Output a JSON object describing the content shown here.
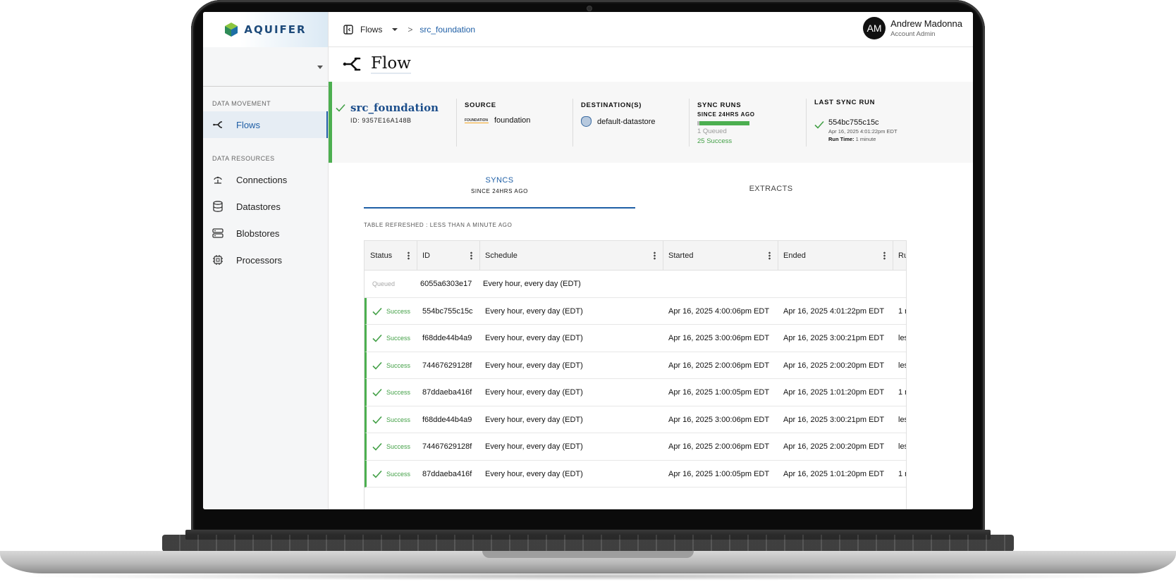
{
  "brand": {
    "name": "AQUIFER"
  },
  "sidebar": {
    "sections": [
      {
        "title": "DATA MOVEMENT",
        "items": [
          {
            "label": "Flows",
            "icon": "flow-icon",
            "active": true
          }
        ]
      },
      {
        "title": "DATA RESOURCES",
        "items": [
          {
            "label": "Connections",
            "icon": "connection-icon"
          },
          {
            "label": "Datastores",
            "icon": "database-icon"
          },
          {
            "label": "Blobstores",
            "icon": "server-icon"
          },
          {
            "label": "Processors",
            "icon": "chip-icon"
          }
        ]
      }
    ]
  },
  "topbar": {
    "breadcrumb": {
      "root": "Flows",
      "separator": ">",
      "current": "src_foundation"
    },
    "user": {
      "initials": "AM",
      "name": "Andrew Madonna",
      "role": "Account Admin"
    }
  },
  "page": {
    "title": "Flow"
  },
  "flow": {
    "name": "src_foundation",
    "id": "ID: 9357E16A148B",
    "source_label": "SOURCE",
    "source_logo_text": "FOUNDATION",
    "source": "foundation",
    "destination_label": "DESTINATION(S)",
    "destination": "default-datastore",
    "sync_runs_label": "SYNC RUNS",
    "sync_runs_sub": "SINCE 24HRS AGO",
    "queued_count": "1 Queued",
    "success_count": "25 Success",
    "last_sync_label": "LAST SYNC RUN",
    "last_sync_id": "554bc755c15c",
    "last_sync_date": "Apr 16, 2025 4:01:22pm EDT",
    "last_sync_runtime_label": "Run Time:",
    "last_sync_runtime": "1 minute"
  },
  "tabs": {
    "syncs": "SYNCS",
    "syncs_sub": "SINCE 24HRS AGO",
    "extracts": "EXTRACTS"
  },
  "table_refreshed": "TABLE REFRESHED : LESS THAN A MINUTE AGO",
  "table": {
    "columns": [
      "Status",
      "ID",
      "Schedule",
      "Started",
      "Ended",
      "Ru"
    ],
    "rows": [
      {
        "status": "Queued",
        "id": "6055a6303e17",
        "schedule": "Every hour, every day (EDT)",
        "started": "",
        "ended": "",
        "runtime": ""
      },
      {
        "status": "Success",
        "id": "554bc755c15c",
        "schedule": "Every hour, every day (EDT)",
        "started": "Apr 16, 2025 4:00:06pm EDT",
        "ended": "Apr 16, 2025 4:01:22pm EDT",
        "runtime": "1 m"
      },
      {
        "status": "Success",
        "id": "f68dde44b4a9",
        "schedule": "Every hour, every day (EDT)",
        "started": "Apr 16, 2025 3:00:06pm EDT",
        "ended": "Apr 16, 2025 3:00:21pm EDT",
        "runtime": "les"
      },
      {
        "status": "Success",
        "id": "74467629128f",
        "schedule": "Every hour, every day (EDT)",
        "started": "Apr 16, 2025 2:00:06pm EDT",
        "ended": "Apr 16, 2025 2:00:20pm EDT",
        "runtime": "les"
      },
      {
        "status": "Success",
        "id": "87ddaeba416f",
        "schedule": "Every hour, every day (EDT)",
        "started": "Apr 16, 2025 1:00:05pm EDT",
        "ended": "Apr 16, 2025 1:01:20pm EDT",
        "runtime": "1 m"
      },
      {
        "status": "Success",
        "id": "f68dde44b4a9",
        "schedule": "Every hour, every day (EDT)",
        "started": "Apr 16, 2025 3:00:06pm EDT",
        "ended": "Apr 16, 2025 3:00:21pm EDT",
        "runtime": "les"
      },
      {
        "status": "Success",
        "id": "74467629128f",
        "schedule": "Every hour, every day (EDT)",
        "started": "Apr 16, 2025 2:00:06pm EDT",
        "ended": "Apr 16, 2025 2:00:20pm EDT",
        "runtime": "les"
      },
      {
        "status": "Success",
        "id": "87ddaeba416f",
        "schedule": "Every hour, every day (EDT)",
        "started": "Apr 16, 2025 1:00:05pm EDT",
        "ended": "Apr 16, 2025 1:01:20pm EDT",
        "runtime": "1 m"
      }
    ]
  },
  "colors": {
    "accent": "#1f5fa6",
    "success": "#43a047",
    "queued": "#a8a8a8",
    "brand": "#1d4a7a"
  }
}
